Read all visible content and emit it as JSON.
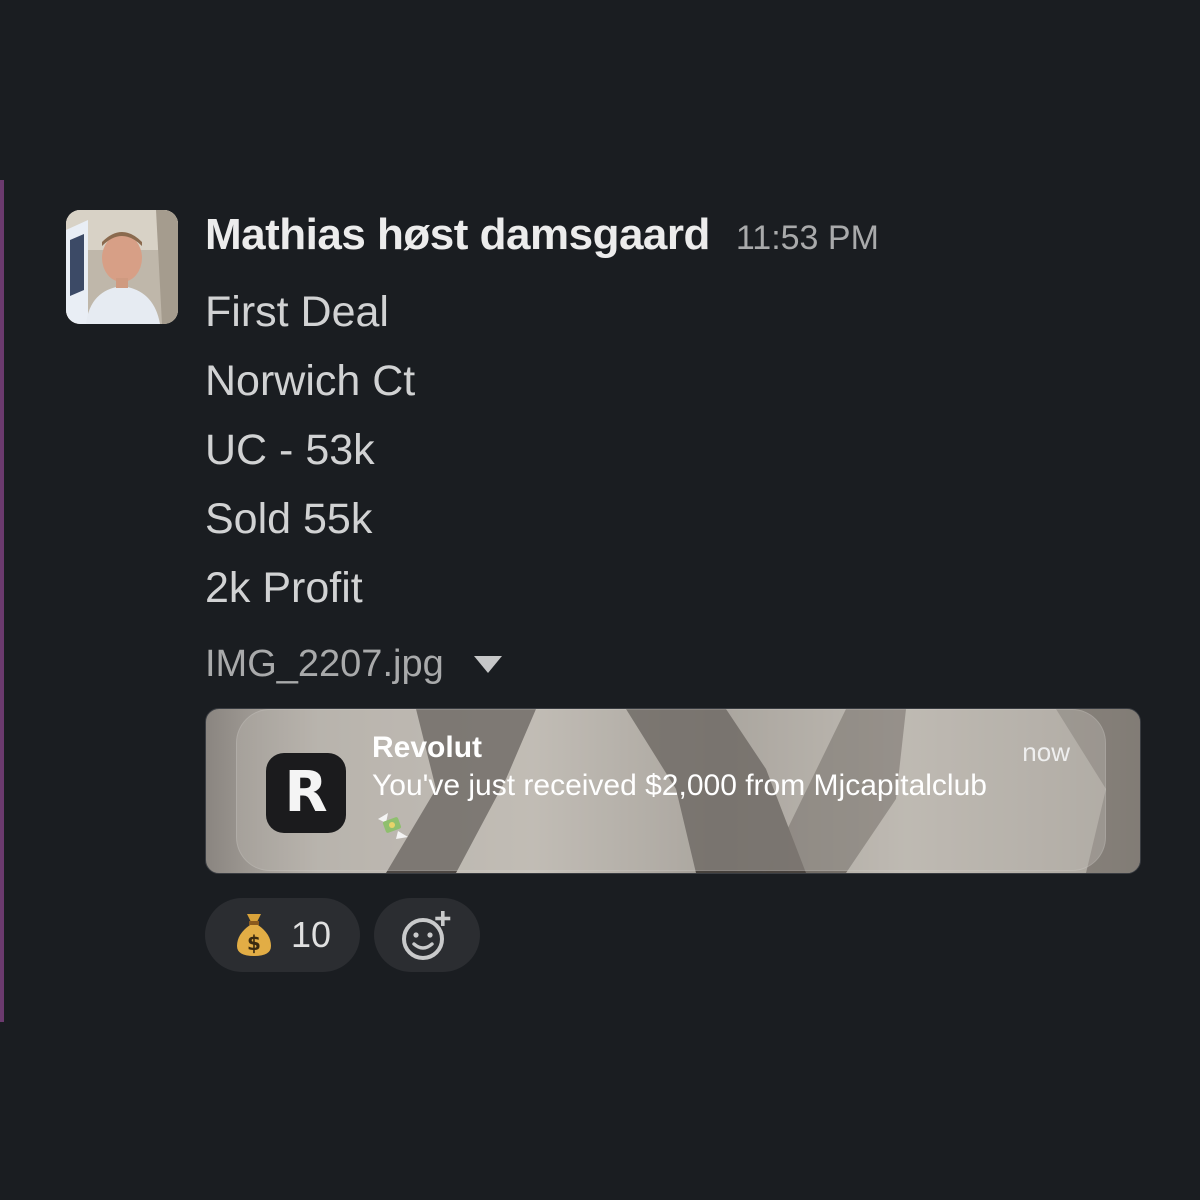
{
  "message": {
    "author": "Mathias høst damsgaard",
    "timestamp": "11:53 PM",
    "lines": [
      "First Deal",
      "Norwich Ct",
      "UC - 53k",
      "Sold 55k",
      "2k Profit"
    ],
    "attachment": {
      "file_name": "IMG_2207.jpg",
      "notification": {
        "app_name": "Revolut",
        "app_icon_letter": "R",
        "time": "now",
        "text": "You've just received $2,000 from Mjcapitalclub",
        "emoji": "money-with-wings-icon"
      }
    },
    "reactions": [
      {
        "emoji": "money-bag-icon",
        "count": "10"
      }
    ],
    "add_reaction_icon": "add-reaction-icon"
  },
  "colors": {
    "background": "#1a1d21",
    "accent_bar": "#6b3a6e",
    "reaction_pill": "#2b2d31"
  }
}
